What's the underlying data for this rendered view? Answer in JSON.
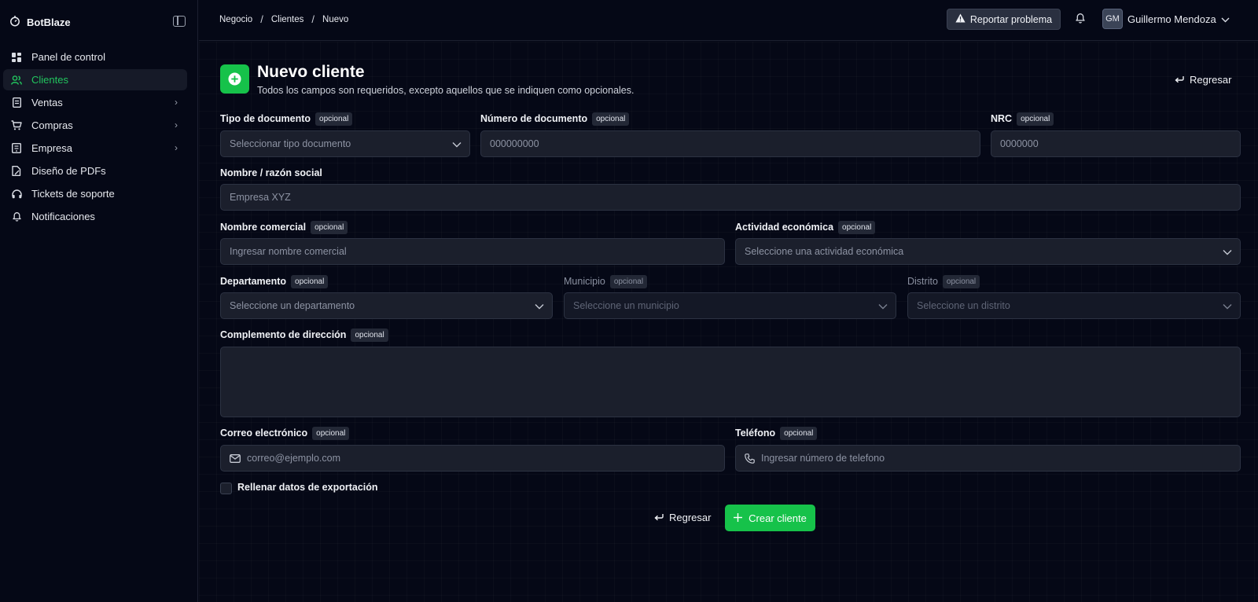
{
  "app": {
    "name": "BotBlaze"
  },
  "sidebar": {
    "items": [
      {
        "label": "Panel de control",
        "icon": "dashboard-icon",
        "active": false,
        "has_submenu": false
      },
      {
        "label": "Clientes",
        "icon": "users-icon",
        "active": true,
        "has_submenu": false
      },
      {
        "label": "Ventas",
        "icon": "receipt-icon",
        "active": false,
        "has_submenu": true
      },
      {
        "label": "Compras",
        "icon": "cart-icon",
        "active": false,
        "has_submenu": true
      },
      {
        "label": "Empresa",
        "icon": "building-icon",
        "active": false,
        "has_submenu": true
      },
      {
        "label": "Diseño de PDFs",
        "icon": "file-design-icon",
        "active": false,
        "has_submenu": false
      },
      {
        "label": "Tickets de soporte",
        "icon": "headphones-icon",
        "active": false,
        "has_submenu": false
      },
      {
        "label": "Notificaciones",
        "icon": "bell-icon",
        "active": false,
        "has_submenu": false
      }
    ]
  },
  "header": {
    "breadcrumb": [
      "Negocio",
      "Clientes",
      "Nuevo"
    ],
    "report_label": "Reportar problema",
    "user": {
      "initials": "GM",
      "name": "Guillermo Mendoza"
    }
  },
  "page": {
    "title": "Nuevo cliente",
    "subtitle": "Todos los campos son requeridos, excepto aquellos que se indiquen como opcionales.",
    "back_label": "Regresar"
  },
  "form": {
    "optional_badge": "opcional",
    "tipo_documento": {
      "label": "Tipo de documento",
      "placeholder": "Seleccionar tipo documento"
    },
    "numero_documento": {
      "label": "Número de documento",
      "placeholder": "000000000"
    },
    "nrc": {
      "label": "NRC",
      "placeholder": "0000000"
    },
    "nombre": {
      "label": "Nombre / razón social",
      "placeholder": "Empresa XYZ"
    },
    "nombre_comercial": {
      "label": "Nombre comercial",
      "placeholder": "Ingresar nombre comercial"
    },
    "actividad": {
      "label": "Actividad económica",
      "placeholder": "Seleccione una actividad económica"
    },
    "departamento": {
      "label": "Departamento",
      "placeholder": "Seleccione un departamento"
    },
    "municipio": {
      "label": "Municipio",
      "placeholder": "Seleccione un municipio"
    },
    "distrito": {
      "label": "Distrito",
      "placeholder": "Seleccione un distrito"
    },
    "complemento": {
      "label": "Complemento de dirección",
      "value": ""
    },
    "correo": {
      "label": "Correo electrónico",
      "placeholder": "correo@ejemplo.com"
    },
    "telefono": {
      "label": "Teléfono",
      "placeholder": "Ingresar número de telefono"
    },
    "exportacion": {
      "label": "Rellenar datos de exportación",
      "checked": false
    }
  },
  "actions": {
    "back_label": "Regresar",
    "create_label": "Crear cliente"
  },
  "colors": {
    "accent": "#16c24a",
    "background": "#050816",
    "field": "#1b1f2c"
  }
}
